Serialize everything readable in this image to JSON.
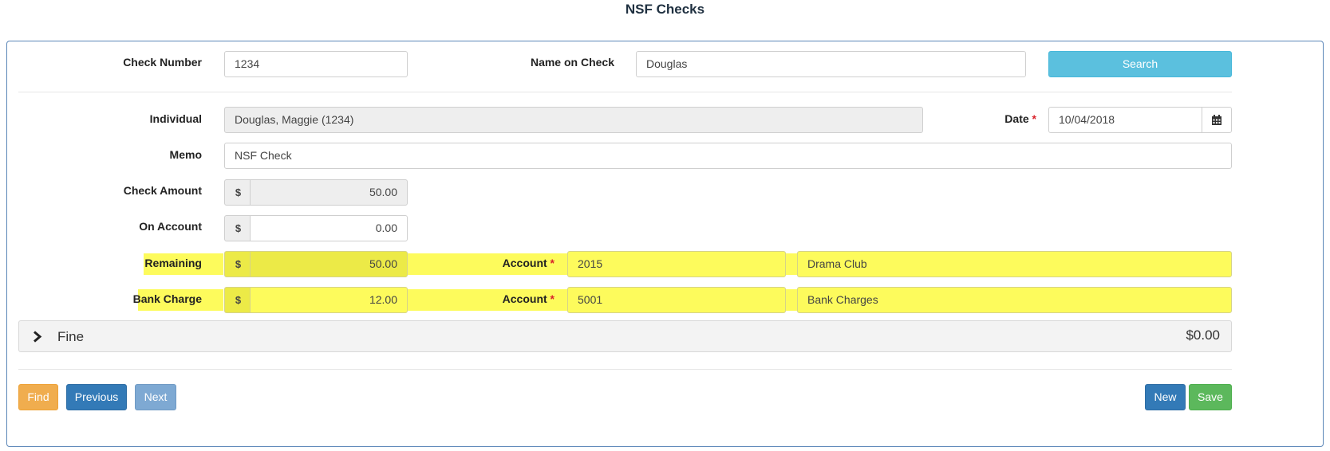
{
  "page": {
    "title": "NSF Checks"
  },
  "search": {
    "check_number_label": "Check Number",
    "check_number_value": "1234",
    "name_on_check_label": "Name on Check",
    "name_on_check_value": "Douglas",
    "search_button": "Search"
  },
  "form": {
    "individual_label": "Individual",
    "individual_value": "Douglas, Maggie (1234)",
    "date_label": "Date",
    "date_value": "10/04/2018",
    "required_mark": "*",
    "memo_label": "Memo",
    "memo_value": "NSF Check",
    "currency_symbol": "$",
    "check_amount_label": "Check Amount",
    "check_amount_value": "50.00",
    "on_account_label": "On Account",
    "on_account_value": "0.00",
    "remaining_label": "Remaining",
    "remaining_value": "50.00",
    "remaining_account_label": "Account",
    "remaining_account_number": "2015",
    "remaining_account_name": "Drama Club",
    "bank_charge_label": "Bank Charge",
    "bank_charge_value": "12.00",
    "bank_account_label": "Account",
    "bank_account_number": "5001",
    "bank_account_name": "Bank Charges"
  },
  "fine": {
    "label": "Fine",
    "amount": "$0.00"
  },
  "footer": {
    "find": "Find",
    "previous": "Previous",
    "next": "Next",
    "new": "New",
    "save": "Save"
  },
  "colors": {
    "highlight": "#fdfb5c",
    "required": "#d9222a",
    "info": "#5bc0de",
    "warning": "#f0ad4e",
    "primary": "#337ab7",
    "success": "#5cb85c"
  },
  "icons": {
    "date_picker": "calendar-icon",
    "fine_toggle": "chevron-right-icon"
  }
}
